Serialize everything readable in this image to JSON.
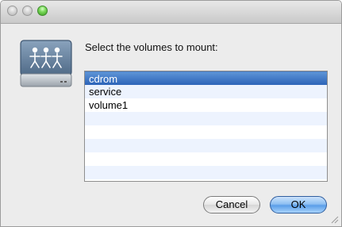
{
  "dialog": {
    "prompt": "Select the volumes to mount:",
    "volumes": [
      "cdrom",
      "service",
      "volume1"
    ],
    "selected_index": 0,
    "cancel_label": "Cancel",
    "ok_label": "OK",
    "icon": "shared-volume-icon"
  },
  "colors": {
    "selection": "#3d76c6",
    "alt_row": "#edf3fe",
    "default_button": "#7ab3f0"
  }
}
